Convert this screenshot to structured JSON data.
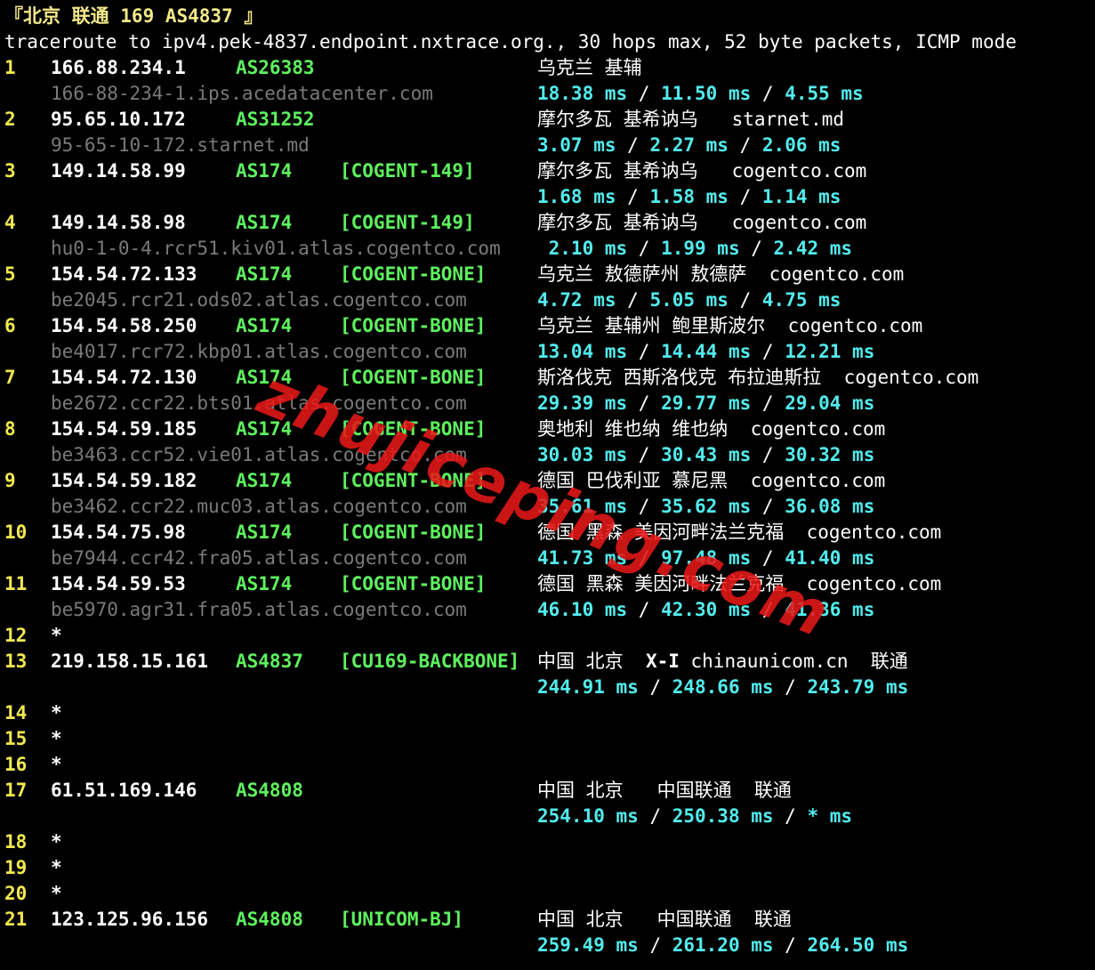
{
  "header": {
    "title": "『北京 联通 169 AS4837 』",
    "command": "traceroute to ipv4.pek-4837.endpoint.nxtrace.org., 30 hops max, 52 byte packets, ICMP mode"
  },
  "hops": [
    {
      "num": "1",
      "ip": "166.88.234.1",
      "asn": "AS26383",
      "tag": "",
      "geo": "乌克兰 基辅",
      "host": "166-88-234-1.ips.acedatacenter.com",
      "rtt": [
        "18.38 ms",
        "11.50 ms",
        "4.55 ms"
      ]
    },
    {
      "num": "2",
      "ip": "95.65.10.172",
      "asn": "AS31252",
      "tag": "",
      "geo": "摩尔多瓦 基希讷乌   starnet.md",
      "host": "95-65-10-172.starnet.md",
      "rtt": [
        "3.07 ms",
        "2.27 ms",
        "2.06 ms"
      ]
    },
    {
      "num": "3",
      "ip": "149.14.58.99",
      "asn": "AS174",
      "tag": "[COGENT-149]",
      "geo": "摩尔多瓦 基希讷乌   cogentco.com",
      "host": "",
      "rtt": [
        "1.68 ms",
        "1.58 ms",
        "1.14 ms"
      ]
    },
    {
      "num": "4",
      "ip": "149.14.58.98",
      "asn": "AS174",
      "tag": "[COGENT-149]",
      "geo": "摩尔多瓦 基希讷乌   cogentco.com",
      "host": "hu0-1-0-4.rcr51.kiv01.atlas.cogentco.com",
      "rtt": [
        " 2.10 ms",
        "1.99 ms",
        "2.42 ms"
      ]
    },
    {
      "num": "5",
      "ip": "154.54.72.133",
      "asn": "AS174",
      "tag": "[COGENT-BONE]",
      "geo": "乌克兰 敖德萨州 敖德萨  cogentco.com",
      "host": "be2045.rcr21.ods02.atlas.cogentco.com",
      "rtt": [
        "4.72 ms",
        "5.05 ms",
        "4.75 ms"
      ]
    },
    {
      "num": "6",
      "ip": "154.54.58.250",
      "asn": "AS174",
      "tag": "[COGENT-BONE]",
      "geo": "乌克兰 基辅州 鲍里斯波尔  cogentco.com",
      "host": "be4017.rcr72.kbp01.atlas.cogentco.com",
      "rtt": [
        "13.04 ms",
        "14.44 ms",
        "12.21 ms"
      ]
    },
    {
      "num": "7",
      "ip": "154.54.72.130",
      "asn": "AS174",
      "tag": "[COGENT-BONE]",
      "geo": "斯洛伐克 西斯洛伐克 布拉迪斯拉  cogentco.com",
      "host": "be2672.ccr22.bts01.atlas.cogentco.com",
      "rtt": [
        "29.39 ms",
        "29.77 ms",
        "29.04 ms"
      ]
    },
    {
      "num": "8",
      "ip": "154.54.59.185",
      "asn": "AS174",
      "tag": "[COGENT-BONE]",
      "geo": "奥地利 维也纳 维也纳  cogentco.com",
      "host": "be3463.ccr52.vie01.atlas.cogentco.com",
      "rtt": [
        "30.03 ms",
        "30.43 ms",
        "30.32 ms"
      ]
    },
    {
      "num": "9",
      "ip": "154.54.59.182",
      "asn": "AS174",
      "tag": "[COGENT-BONE]",
      "geo": "德国 巴伐利亚 慕尼黑  cogentco.com",
      "host": "be3462.ccr22.muc03.atlas.cogentco.com",
      "rtt": [
        "35.61 ms",
        "35.62 ms",
        "36.08 ms"
      ]
    },
    {
      "num": "10",
      "ip": "154.54.75.98",
      "asn": "AS174",
      "tag": "[COGENT-BONE]",
      "geo": "德国 黑森 美因河畔法兰克福  cogentco.com",
      "host": "be7944.ccr42.fra05.atlas.cogentco.com",
      "rtt": [
        "41.73 ms",
        "97.48 ms",
        "41.40 ms"
      ]
    },
    {
      "num": "11",
      "ip": "154.54.59.53",
      "asn": "AS174",
      "tag": "[COGENT-BONE]",
      "geo": "德国 黑森 美因河畔法兰克福  cogentco.com",
      "host": "be5970.agr31.fra05.atlas.cogentco.com",
      "rtt": [
        "46.10 ms",
        "42.30 ms",
        "41.36 ms"
      ]
    },
    {
      "num": "12",
      "star": "*"
    },
    {
      "num": "13",
      "ip": "219.158.15.161",
      "asn": "AS4837",
      "tag": "[CU169-BACKBONE]",
      "geo_pre": "中国 北京  ",
      "geo_bold": "X-I",
      "geo_post": " chinaunicom.cn  联通",
      "host": "",
      "rtt": [
        "244.91 ms",
        "248.66 ms",
        "243.79 ms"
      ]
    },
    {
      "num": "14",
      "star": "*"
    },
    {
      "num": "15",
      "star": "*"
    },
    {
      "num": "16",
      "star": "*"
    },
    {
      "num": "17",
      "ip": "61.51.169.146",
      "asn": "AS4808",
      "tag": "",
      "geo": "中国 北京   中国联通  联通",
      "host": "",
      "rtt": [
        "254.10 ms",
        "250.38 ms",
        "* ms"
      ]
    },
    {
      "num": "18",
      "star": "*"
    },
    {
      "num": "19",
      "star": "*"
    },
    {
      "num": "20",
      "star": "*"
    },
    {
      "num": "21",
      "ip": "123.125.96.156",
      "asn": "AS4808",
      "tag": "[UNICOM-BJ]",
      "geo": "中国 北京   中国联通  联通",
      "host": "",
      "rtt": [
        "259.49 ms",
        "261.20 ms",
        "264.50 ms"
      ]
    }
  ],
  "rtt_separator": " / ",
  "watermark": "zhujiceping.com",
  "colors": {
    "background": "#000000",
    "hop_number": "#f2e94e",
    "asn": "#5ef25e",
    "hostname": "#7a7a7a",
    "rtt": "#52ecee",
    "watermark": "#e61818"
  }
}
